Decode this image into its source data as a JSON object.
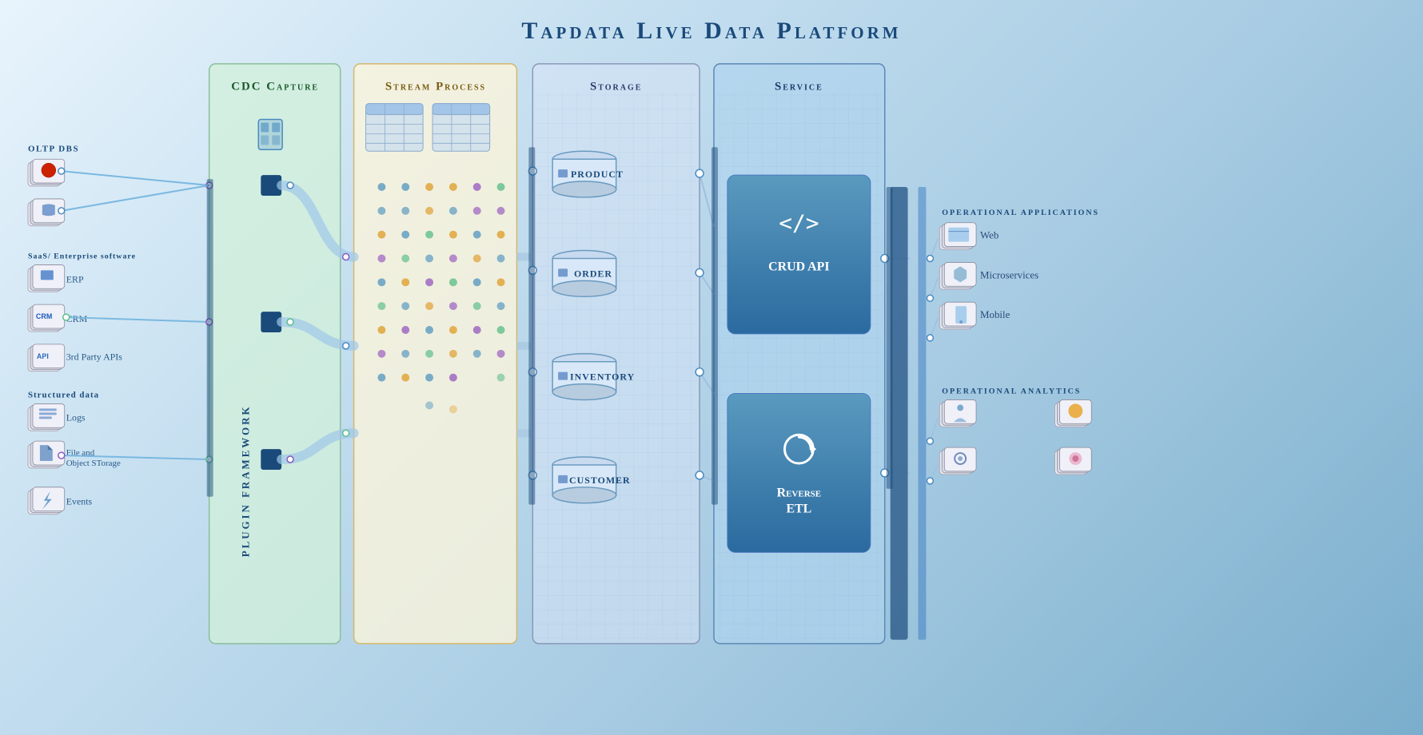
{
  "title": "Tapdata Live Data Platform",
  "columns": {
    "cdc": {
      "label": "CDC Capture",
      "color_bg": "rgba(210,235,215,0.75)",
      "color_border": "#8abf9a",
      "color_text": "#1a5a2a"
    },
    "stream": {
      "label": "Stream Process",
      "color_bg": "rgba(255,245,215,0.75)",
      "color_border": "#d4b86a",
      "color_text": "#7a5a10"
    },
    "storage": {
      "label": "Storage",
      "color_bg": "rgba(215,225,240,0.6)",
      "color_border": "#8898b8",
      "color_text": "#2a3a6a"
    },
    "service": {
      "label": "Service",
      "color_bg": "rgba(175,210,235,0.65)",
      "color_border": "#5a88b8",
      "color_text": "#1a3a6a"
    }
  },
  "left": {
    "groups": [
      {
        "title": "OLTP DBS",
        "items": [
          {
            "label": "",
            "icon": "oracle"
          },
          {
            "label": "",
            "icon": "db"
          }
        ]
      },
      {
        "title": "SaaS/ Enterprise software",
        "items": [
          {
            "label": "ERP",
            "icon": "erp"
          },
          {
            "label": "CRM",
            "icon": "crm"
          },
          {
            "label": "3rd Party APIs",
            "icon": "api"
          }
        ]
      },
      {
        "title": "Structured data",
        "items": [
          {
            "label": "Logs",
            "icon": "logs"
          },
          {
            "label": "File and Object STorage",
            "icon": "file"
          },
          {
            "label": "Events",
            "icon": "events"
          }
        ]
      }
    ]
  },
  "plugin_framework": "Plugin Framework",
  "storage_tables": [
    {
      "label": "PRODUCT"
    },
    {
      "label": "ORDER"
    },
    {
      "label": "INVENTORY"
    },
    {
      "label": "CUSTOMER"
    }
  ],
  "service_cards": [
    {
      "title": "CRUD API",
      "icon": "<>"
    },
    {
      "title": "Reverse ETL",
      "icon": "↻"
    }
  ],
  "right": {
    "groups": [
      {
        "title": "OPERATIONAL APPLICATIONS",
        "items": [
          {
            "label": "Web",
            "icon": "web"
          },
          {
            "label": "Microservices",
            "icon": "microservices"
          },
          {
            "label": "Mobile",
            "icon": "mobile"
          }
        ]
      },
      {
        "title": "OPERATIONAL ANALYTICS",
        "items": [
          {
            "label": "",
            "icon": "analytics1"
          },
          {
            "label": "",
            "icon": "analytics2"
          },
          {
            "label": "",
            "icon": "analytics3"
          },
          {
            "label": "",
            "icon": "analytics4"
          }
        ]
      }
    ]
  }
}
